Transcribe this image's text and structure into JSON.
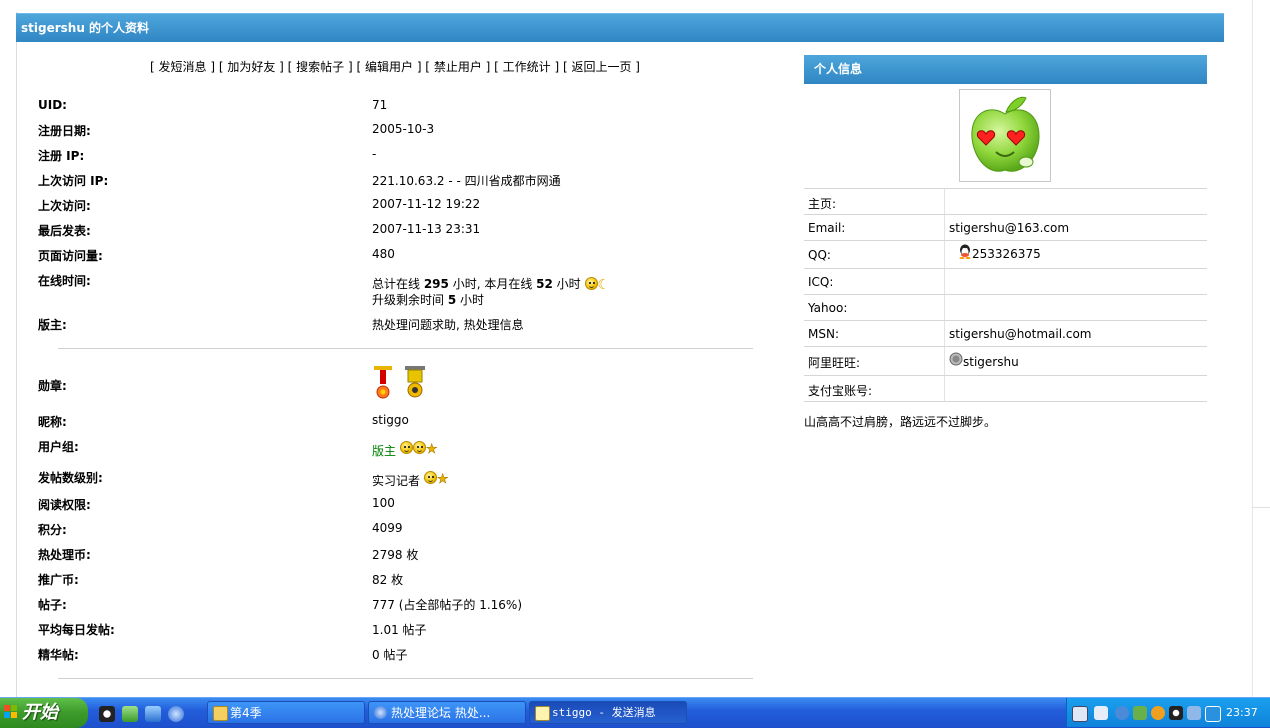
{
  "header": {
    "title": "stigershu 的个人资料"
  },
  "actions": [
    {
      "label": "发短消息"
    },
    {
      "label": "加为好友"
    },
    {
      "label": "搜索帖子"
    },
    {
      "label": "编辑用户"
    },
    {
      "label": "禁止用户"
    },
    {
      "label": "工作统计"
    },
    {
      "label": "返回上一页"
    }
  ],
  "profile": {
    "uid": {
      "label": "UID:",
      "value": "71"
    },
    "regdate": {
      "label": "注册日期:",
      "value": "2005-10-3"
    },
    "regip": {
      "label": "注册 IP:",
      "value": "-"
    },
    "lastip": {
      "label": "上次访问 IP:",
      "value": "221.10.63.2 - - 四川省成都市网通"
    },
    "lastvisit": {
      "label": "上次访问:",
      "value": "2007-11-12 19:22"
    },
    "lastpost": {
      "label": "最后发表:",
      "value": "2007-11-13 23:31"
    },
    "pageviews": {
      "label": "页面访问量:",
      "value": "480"
    },
    "online": {
      "label": "在线时间:",
      "prefix": "总计在线 ",
      "total": "295",
      "mid": " 小时, 本月在线 ",
      "month": "52",
      "suffix": " 小时",
      "up_prefix": "升级剩余时间 ",
      "up_hours": "5",
      "up_suffix": " 小时"
    },
    "moderator": {
      "label": "版主:",
      "value": "热处理问题求助, 热处理信息"
    }
  },
  "profile2": {
    "medals": {
      "label": "勋章:"
    },
    "nickname": {
      "label": "昵称:",
      "value": "stiggo"
    },
    "group": {
      "label": "用户组:",
      "value": "版主"
    },
    "postlevel": {
      "label": "发帖数级别:",
      "value": "实习记者"
    },
    "readperm": {
      "label": "阅读权限:",
      "value": "100"
    },
    "credits": {
      "label": "积分:",
      "value": "4099"
    },
    "coins": {
      "label": "热处理币:",
      "value": "2798 枚"
    },
    "promo": {
      "label": "推广币:",
      "value": "82 枚"
    },
    "posts": {
      "label": "帖子:",
      "value": "777 (占全部帖子的 1.16%)"
    },
    "avgposts": {
      "label": "平均每日发帖:",
      "value": "1.01 帖子"
    },
    "digest": {
      "label": "精华帖:",
      "value": "0 帖子"
    }
  },
  "side": {
    "title": "个人信息",
    "rows": [
      {
        "key": "主页:",
        "value": ""
      },
      {
        "key": "Email:",
        "value": "stigershu@163.com"
      },
      {
        "key": "QQ:",
        "value": "253326375",
        "icon": "qq-icon"
      },
      {
        "key": "ICQ:",
        "value": ""
      },
      {
        "key": "Yahoo:",
        "value": ""
      },
      {
        "key": "MSN:",
        "value": "stigershu@hotmail.com"
      },
      {
        "key": "阿里旺旺:",
        "value": "stigershu",
        "icon": "wangwang-icon"
      },
      {
        "key": "支付宝账号:",
        "value": ""
      }
    ],
    "motto": "山高高不过肩膀，路远远不过脚步。"
  },
  "taskbar": {
    "start": "开始",
    "tasks": [
      {
        "label": "第4季",
        "icon": "folder-icon"
      },
      {
        "label": "热处理论坛 热处...",
        "icon": "maxthon-icon"
      },
      {
        "label": "stiggo - 发送消息",
        "icon": "notepad-icon"
      }
    ],
    "clock": "23:37"
  },
  "colors": {
    "header_blue": "#2f86c3",
    "group_green": "#008000"
  }
}
